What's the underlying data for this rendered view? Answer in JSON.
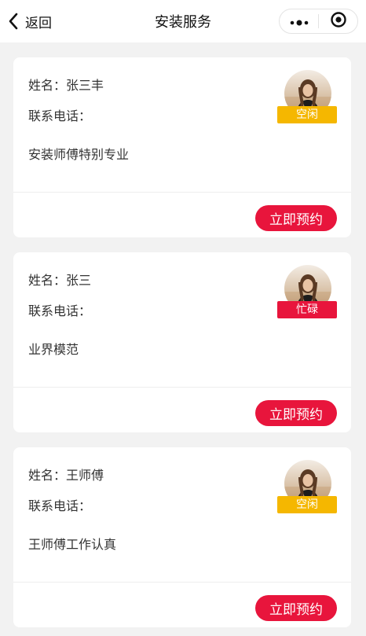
{
  "nav": {
    "back_label": "返回",
    "title": "安装服务"
  },
  "colors": {
    "accent": "#e8153c",
    "status_free": "#f5b700",
    "status_busy": "#e8153c"
  },
  "technicians": [
    {
      "name_text": "姓名：张三丰",
      "phone_text": "联系电话：",
      "description": "安装师傅特别专业",
      "status": "空闲",
      "status_type": "free",
      "book_label": "立即预约"
    },
    {
      "name_text": "姓名：张三",
      "phone_text": "联系电话：",
      "description": "业界模范",
      "status": "忙碌",
      "status_type": "busy",
      "book_label": "立即预约"
    },
    {
      "name_text": "姓名：王师傅",
      "phone_text": "联系电话：",
      "description": "王师傅工作认真",
      "status": "空闲",
      "status_type": "free",
      "book_label": "立即预约"
    }
  ]
}
